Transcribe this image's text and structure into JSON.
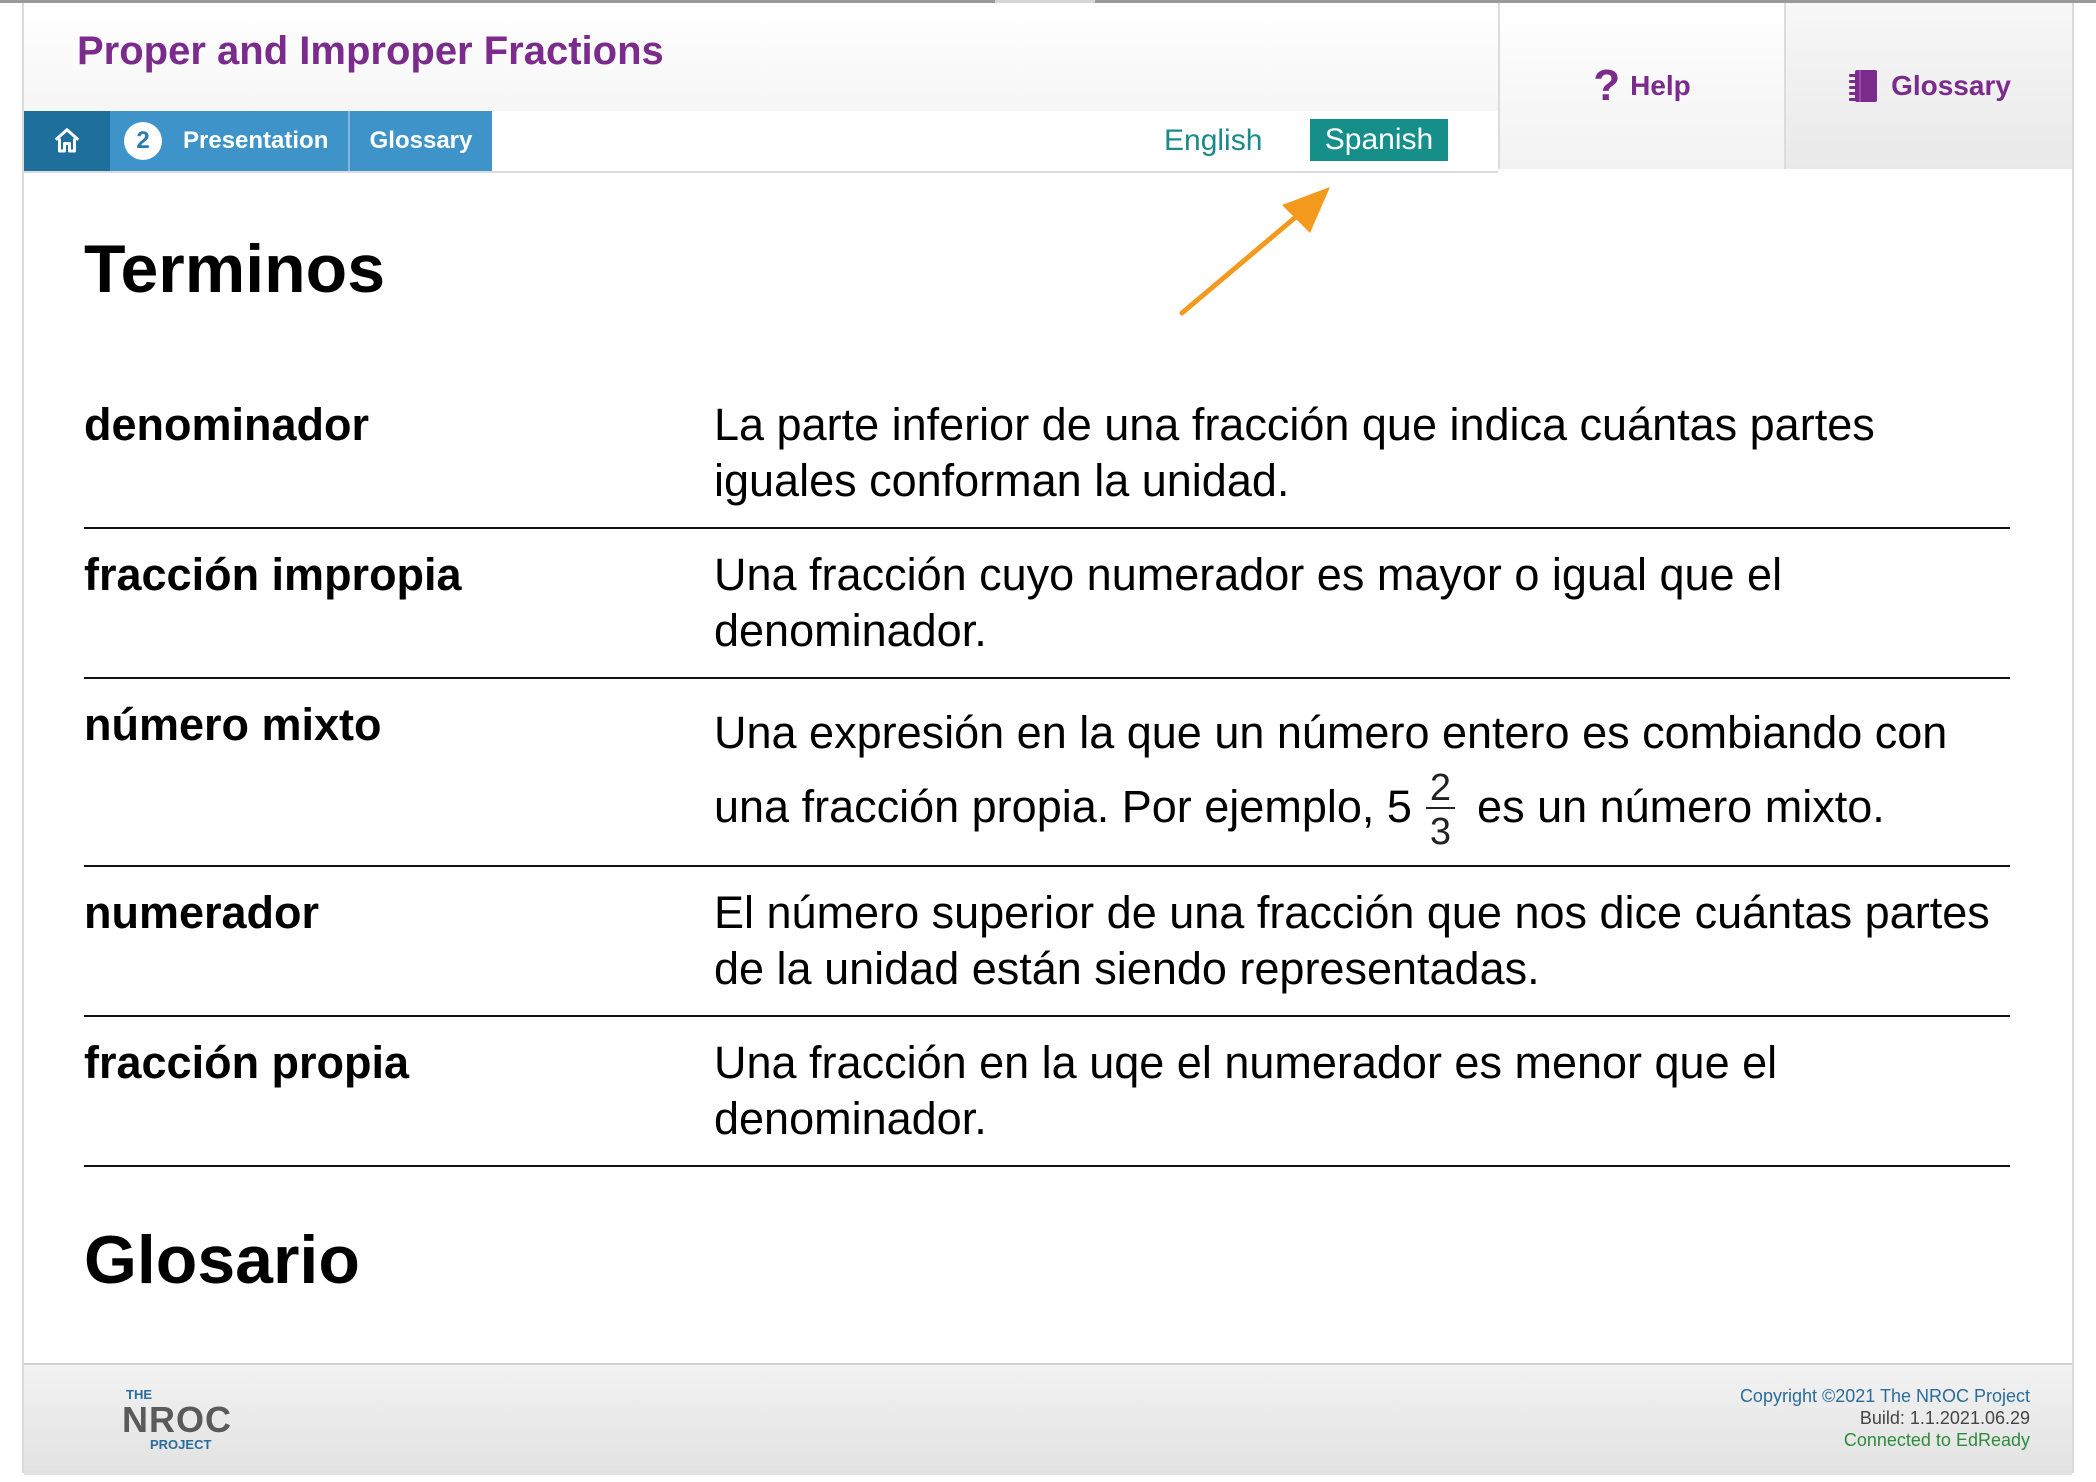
{
  "app": {
    "title": "Proper and Improper Fractions"
  },
  "nav": {
    "step_number": "2",
    "presentation_label": "Presentation",
    "glossary_label": "Glossary"
  },
  "language": {
    "english_label": "English",
    "spanish_label": "Spanish",
    "selected": "Spanish"
  },
  "sidebar_buttons": {
    "help_label": "Help",
    "glossary_label": "Glossary"
  },
  "content": {
    "section_title": "Terminos",
    "terms": [
      {
        "term": "denominador",
        "definition": "La parte inferior de una fracción que indica cuántas partes iguales conforman la unidad."
      },
      {
        "term": "fracción impropia",
        "definition": "Una fracción cuyo numerador es mayor o igual que el denominador."
      },
      {
        "term": "número mixto",
        "definition_before": "Una expresión en la que un número entero es combiando con una fracción propia. Por ejemplo, 5",
        "fraction_numerator": "2",
        "fraction_denominator": "3",
        "definition_after": "es un número mixto."
      },
      {
        "term": "numerador",
        "definition": "El número superior de una fracción que nos dice cuántas partes de la unidad están siendo representadas."
      },
      {
        "term": "fracción propia",
        "definition": "Una fracción en la uqe el numerador es menor que el denominador."
      }
    ],
    "next_section_title": "Glosario"
  },
  "footer": {
    "logo_the": "THE",
    "logo_nroc": "NROC",
    "logo_project": "PROJECT",
    "copyright": "Copyright ©2021 The NROC Project",
    "build": "Build: 1.1.2021.06.29",
    "connection_status": "Connected to EdReady"
  },
  "colors": {
    "title_purple": "#7a2b8c",
    "nav_blue": "#3e93c9",
    "nav_home_blue": "#1f6f9d",
    "lang_teal": "#168f8a",
    "arrow_orange": "#f39a1e"
  }
}
